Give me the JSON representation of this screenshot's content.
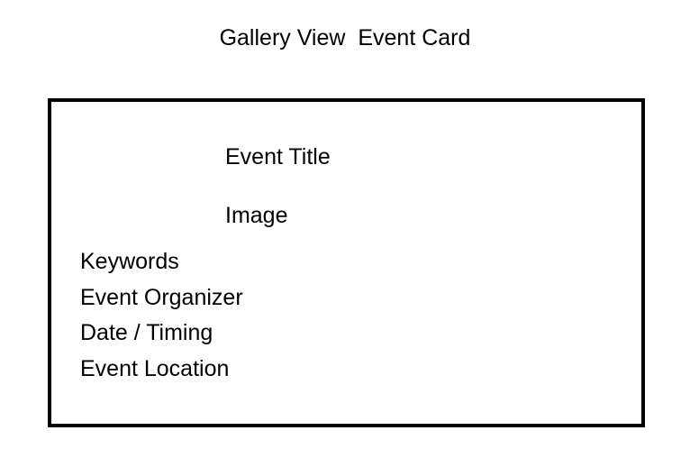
{
  "heading": "Gallery View  Event Card",
  "card": {
    "title": "Event Title",
    "image": "Image",
    "details": [
      "Keywords",
      "Event Organizer",
      "Date / Timing",
      "Event Location"
    ]
  }
}
